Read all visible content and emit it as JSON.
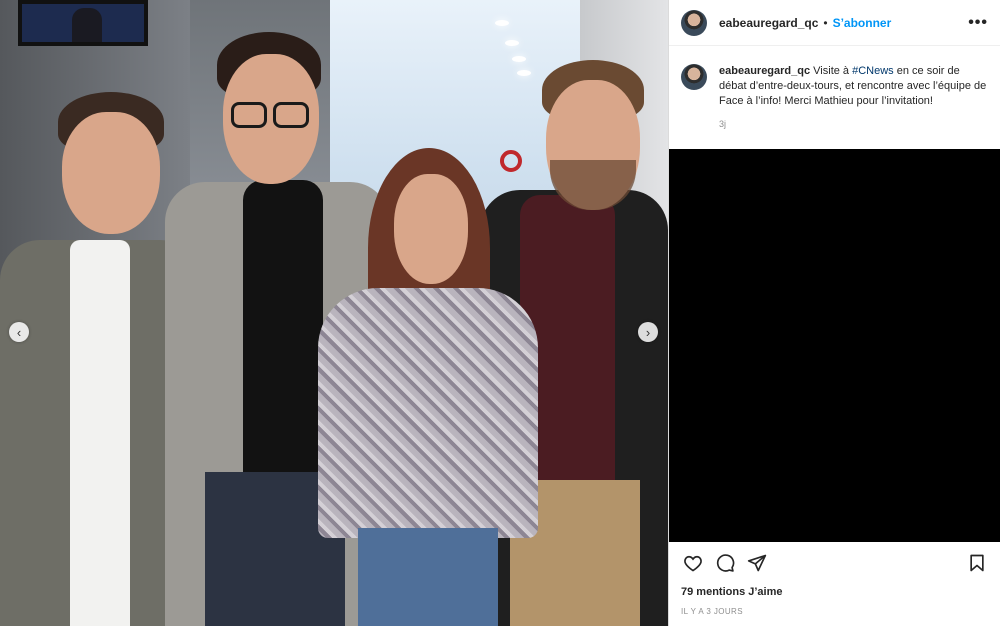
{
  "post": {
    "username": "eabeauregard_qc",
    "separator": "•",
    "follow_label": "S’abonner",
    "more_label": "•••",
    "caption": {
      "username": "eabeauregard_qc",
      "text_before": "Visite à ",
      "hashtag": "#CNews",
      "text_after": " en ce soir de débat d’entre-deux-tours, et rencontre avec l’équipe de Face à l’info! Merci Mathieu pour l’invitation!",
      "time": "3j"
    },
    "likes": "79 mentions J’aime",
    "date": "IL Y A 3 JOURS"
  },
  "carousel": {
    "prev_label": "‹",
    "next_label": "›"
  },
  "icons": {
    "like": "heart-icon",
    "comment": "comment-icon",
    "share": "share-icon",
    "save": "bookmark-icon",
    "more": "more-options-icon"
  },
  "colors": {
    "follow": "#0095f6",
    "hashtag": "#00376b",
    "muted": "#8e8e8e",
    "media_bg": "#000000"
  }
}
